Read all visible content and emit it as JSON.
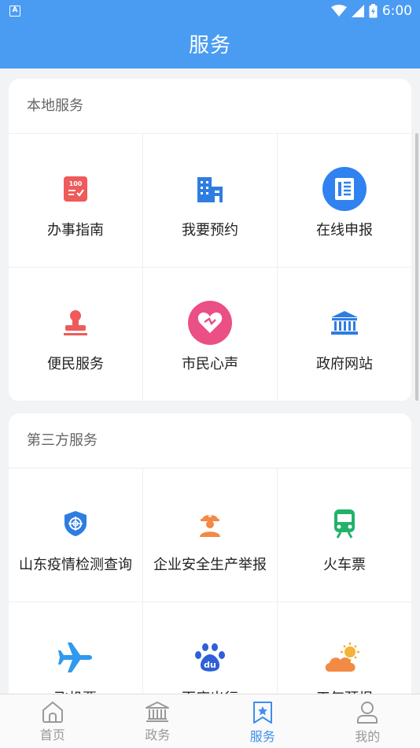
{
  "status_bar": {
    "left_badge": "A",
    "time": "6:00",
    "icons": [
      "wifi-icon",
      "signal-icon",
      "battery-icon"
    ]
  },
  "header": {
    "title": "服务"
  },
  "sections": [
    {
      "title": "本地服务",
      "items": [
        {
          "label": "办事指南",
          "icon": "guide-doc-icon"
        },
        {
          "label": "我要预约",
          "icon": "building-icon"
        },
        {
          "label": "在线申报",
          "icon": "online-report-icon"
        },
        {
          "label": "便民服务",
          "icon": "stamp-icon"
        },
        {
          "label": "市民心声",
          "icon": "heart-icon"
        },
        {
          "label": "政府网站",
          "icon": "government-building-icon"
        }
      ]
    },
    {
      "title": "第三方服务",
      "items": [
        {
          "label": "山东疫情检测查询",
          "icon": "shield-icon"
        },
        {
          "label": "企业安全生产举报",
          "icon": "worker-helmet-icon"
        },
        {
          "label": "火车票",
          "icon": "train-icon"
        },
        {
          "label": "飞机票",
          "icon": "airplane-icon"
        },
        {
          "label": "百度出行",
          "icon": "baidu-paw-icon"
        },
        {
          "label": "天气预报",
          "icon": "weather-icon"
        }
      ]
    }
  ],
  "tab_bar": {
    "active": "服务",
    "tabs": [
      {
        "label": "首页",
        "icon": "home-icon"
      },
      {
        "label": "政务",
        "icon": "bank-icon"
      },
      {
        "label": "服务",
        "icon": "bookmark-star-icon"
      },
      {
        "label": "我的",
        "icon": "user-icon"
      }
    ]
  },
  "colors": {
    "primary": "#4a9cf3",
    "tab_active": "#3d8ef0",
    "tab_inactive": "#999999",
    "red": "#ef5a5a",
    "blue": "#2f82ef",
    "green": "#21b26a",
    "orange": "#f28a45"
  }
}
